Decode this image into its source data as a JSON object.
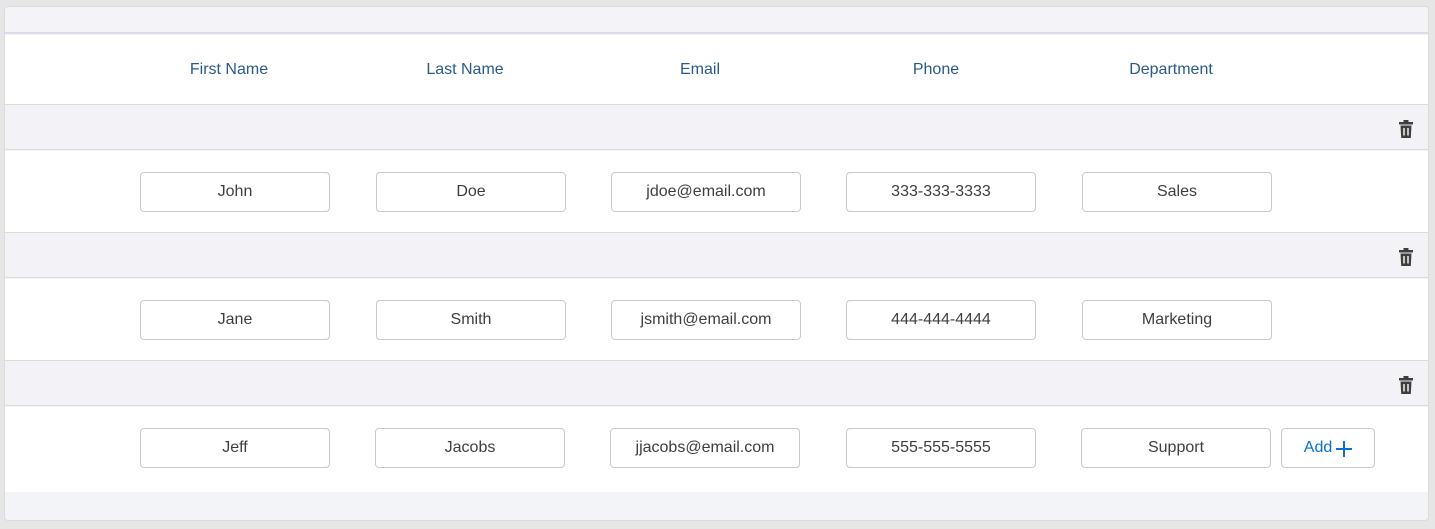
{
  "columns": {
    "first_name": "First Name",
    "last_name": "Last Name",
    "email": "Email",
    "phone": "Phone",
    "department": "Department"
  },
  "rows": [
    {
      "first_name": "John",
      "last_name": "Doe",
      "email": "jdoe@email.com",
      "phone": "333-333-3333",
      "department": "Sales"
    },
    {
      "first_name": "Jane",
      "last_name": "Smith",
      "email": "jsmith@email.com",
      "phone": "444-444-4444",
      "department": "Marketing"
    },
    {
      "first_name": "Jeff",
      "last_name": "Jacobs",
      "email": "jjacobs@email.com",
      "phone": "555-555-5555",
      "department": "Support"
    }
  ],
  "actions": {
    "add_label": "Add",
    "add_icon": "plus-icon",
    "delete_icon": "trash-icon"
  },
  "colors": {
    "header_text": "#2b5a8a",
    "accent": "#0a6ed1",
    "row_bar": "#f3f3f7"
  }
}
